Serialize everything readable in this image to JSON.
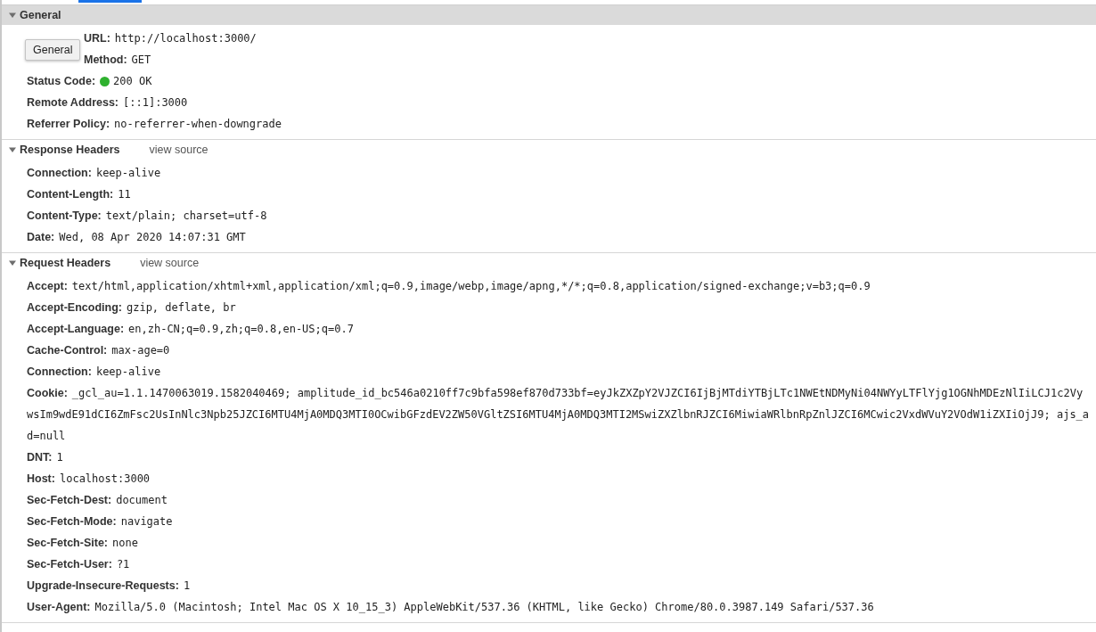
{
  "tooltip": {
    "text": "General"
  },
  "sections": [
    {
      "title": "General",
      "expanded": true,
      "highlighted": true,
      "rows": [
        {
          "kind": "plain",
          "name": "URL:",
          "covered": true,
          "value": "http://localhost:3000/"
        },
        {
          "kind": "plain",
          "name": "Method:",
          "covered": true,
          "value": "GET"
        },
        {
          "kind": "status",
          "name": "Status Code:",
          "value": "200 OK",
          "color": "#2fb12f"
        },
        {
          "kind": "plain",
          "name": "Remote Address:",
          "value": "[::1]:3000"
        },
        {
          "kind": "plain",
          "name": "Referrer Policy:",
          "value": "no-referrer-when-downgrade"
        }
      ]
    },
    {
      "title": "Response Headers",
      "expanded": true,
      "highlighted": false,
      "view_source": "view source",
      "rows": [
        {
          "kind": "plain",
          "name": "Connection:",
          "value": "keep-alive"
        },
        {
          "kind": "plain",
          "name": "Content-Length:",
          "value": "11"
        },
        {
          "kind": "plain",
          "name": "Content-Type:",
          "value": "text/plain; charset=utf-8"
        },
        {
          "kind": "plain",
          "name": "Date:",
          "value": "Wed, 08 Apr 2020 14:07:31 GMT"
        }
      ]
    },
    {
      "title": "Request Headers",
      "expanded": true,
      "highlighted": false,
      "view_source": "view source",
      "rows": [
        {
          "kind": "plain",
          "name": "Accept:",
          "value": "text/html,application/xhtml+xml,application/xml;q=0.9,image/webp,image/apng,*/*;q=0.8,application/signed-exchange;v=b3;q=0.9"
        },
        {
          "kind": "plain",
          "name": "Accept-Encoding:",
          "value": "gzip, deflate, br"
        },
        {
          "kind": "plain",
          "name": "Accept-Language:",
          "value": "en,zh-CN;q=0.9,zh;q=0.8,en-US;q=0.7"
        },
        {
          "kind": "plain",
          "name": "Cache-Control:",
          "value": "max-age=0"
        },
        {
          "kind": "plain",
          "name": "Connection:",
          "value": "keep-alive"
        },
        {
          "kind": "wrapped",
          "name": "Cookie:",
          "lines": [
            "_gcl_au=1.1.1470063019.1582040469; amplitude_id_bc546a0210ff7c9bfa598ef870d733bf=eyJkZXZpY2VJZCI6IjBjMTdiYTBjLTc1NWEtNDMyNi04NWYyLTFlYjg1OGNhMDEzNlIiLCJ1c2Vy",
            "wsIm9wdE91dCI6ZmFsc2UsInNlc3Npb25JZCI6MTU4MjA0MDQ3MTI0OCwibGFzdEV2ZW50VGltZSI6MTU4MjA0MDQ3MTI2MSwiZXZlbnRJZCI6MiwiaWRlbnRpZnlJZCI6MCwic2VxdWVuY2VOdW1iZXIiOjJ9; ajs_a",
            "d=null"
          ]
        },
        {
          "kind": "plain",
          "name": "DNT:",
          "value": "1"
        },
        {
          "kind": "plain",
          "name": "Host:",
          "value": "localhost:3000"
        },
        {
          "kind": "plain",
          "name": "Sec-Fetch-Dest:",
          "value": "document"
        },
        {
          "kind": "plain",
          "name": "Sec-Fetch-Mode:",
          "value": "navigate"
        },
        {
          "kind": "plain",
          "name": "Sec-Fetch-Site:",
          "value": "none"
        },
        {
          "kind": "plain",
          "name": "Sec-Fetch-User:",
          "value": "?1"
        },
        {
          "kind": "plain",
          "name": "Upgrade-Insecure-Requests:",
          "value": "1"
        },
        {
          "kind": "plain",
          "name": "User-Agent:",
          "value": "Mozilla/5.0 (Macintosh; Intel Mac OS X 10_15_3) AppleWebKit/537.36 (KHTML, like Gecko) Chrome/80.0.3987.149 Safari/537.36"
        }
      ]
    }
  ]
}
